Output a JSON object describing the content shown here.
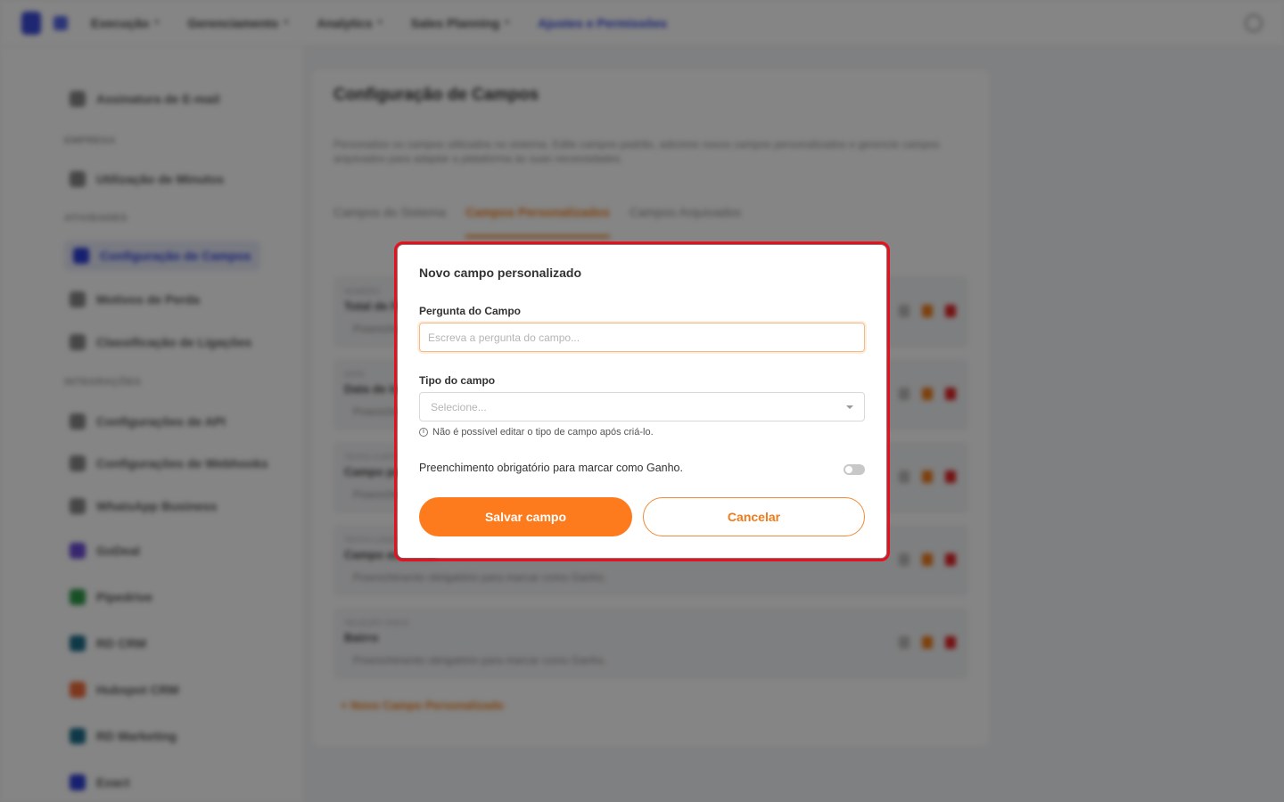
{
  "topbar": {
    "nav": [
      {
        "label": "Execução"
      },
      {
        "label": "Gerenciamento"
      },
      {
        "label": "Analytics"
      },
      {
        "label": "Sales Planning"
      },
      {
        "label": "Ajustes e Permissões"
      }
    ]
  },
  "sidebar": {
    "items": [
      {
        "label": "Assinatura de E-mail"
      },
      {
        "label": "Utilização de Minutos"
      },
      {
        "label": "Configuração de Campos"
      },
      {
        "label": "Motivos de Perda"
      },
      {
        "label": "Classificação de Ligações"
      },
      {
        "label": "Configurações de API"
      },
      {
        "label": "Configurações de Webhooks"
      },
      {
        "label": "WhatsApp Business"
      },
      {
        "label": "GoDeal"
      },
      {
        "label": "Pipedrive"
      },
      {
        "label": "RD CRM"
      },
      {
        "label": "Hubspot CRM"
      },
      {
        "label": "RD Marketing"
      },
      {
        "label": "Exact"
      }
    ],
    "sections": [
      {
        "label": "EMPRESA"
      },
      {
        "label": "ATIVIDADES"
      },
      {
        "label": "INTEGRAÇÕES"
      }
    ]
  },
  "content": {
    "title": "Configuração de Campos",
    "description": "Personalize os campos utilizados no sistema. Edite campos padrão, adicione novos campos personalizados e gerencie campos arquivados para adaptar a plataforma às suas necessidades.",
    "tabs": [
      {
        "label": "Campos do Sistema"
      },
      {
        "label": "Campos Personalizados"
      },
      {
        "label": "Campos Arquivados"
      }
    ],
    "fields": [
      {
        "meta": "NÚMERO",
        "name": "Total de Funcionários",
        "required": "Preenchimento obrigatório para marcar como Ganho."
      },
      {
        "meta": "DATA",
        "name": "Data de Início",
        "required": "Preenchimento obrigatório para marcar como Ganho."
      },
      {
        "meta": "TEXTO CURTO",
        "name": "Campo personalizado",
        "required": "Preenchimento obrigatório para marcar como Ganho."
      },
      {
        "meta": "TEXTO LONGO",
        "name": "Campo adicional",
        "required": "Preenchimento obrigatório para marcar como Ganho."
      },
      {
        "meta": "SELEÇÃO ÚNICA",
        "name": "Bairro",
        "required": "Preenchimento obrigatório para marcar como Ganho."
      }
    ],
    "add_link": "+ Novo Campo Personalizado"
  },
  "modal": {
    "title": "Novo campo personalizado",
    "question_label": "Pergunta do Campo",
    "question_placeholder": "Escreva a pergunta do campo...",
    "question_value": "",
    "type_label": "Tipo do campo",
    "type_placeholder": "Selecione...",
    "type_hint": "Não é possível editar o tipo de campo após criá-lo.",
    "required_label": "Preenchimento obrigatório para marcar como Ganho.",
    "required_on": false,
    "save_label": "Salvar campo",
    "cancel_label": "Cancelar"
  },
  "colors": {
    "accent": "#fd7b1d",
    "highlight": "#e8101c",
    "brand": "#2d3fd6"
  }
}
